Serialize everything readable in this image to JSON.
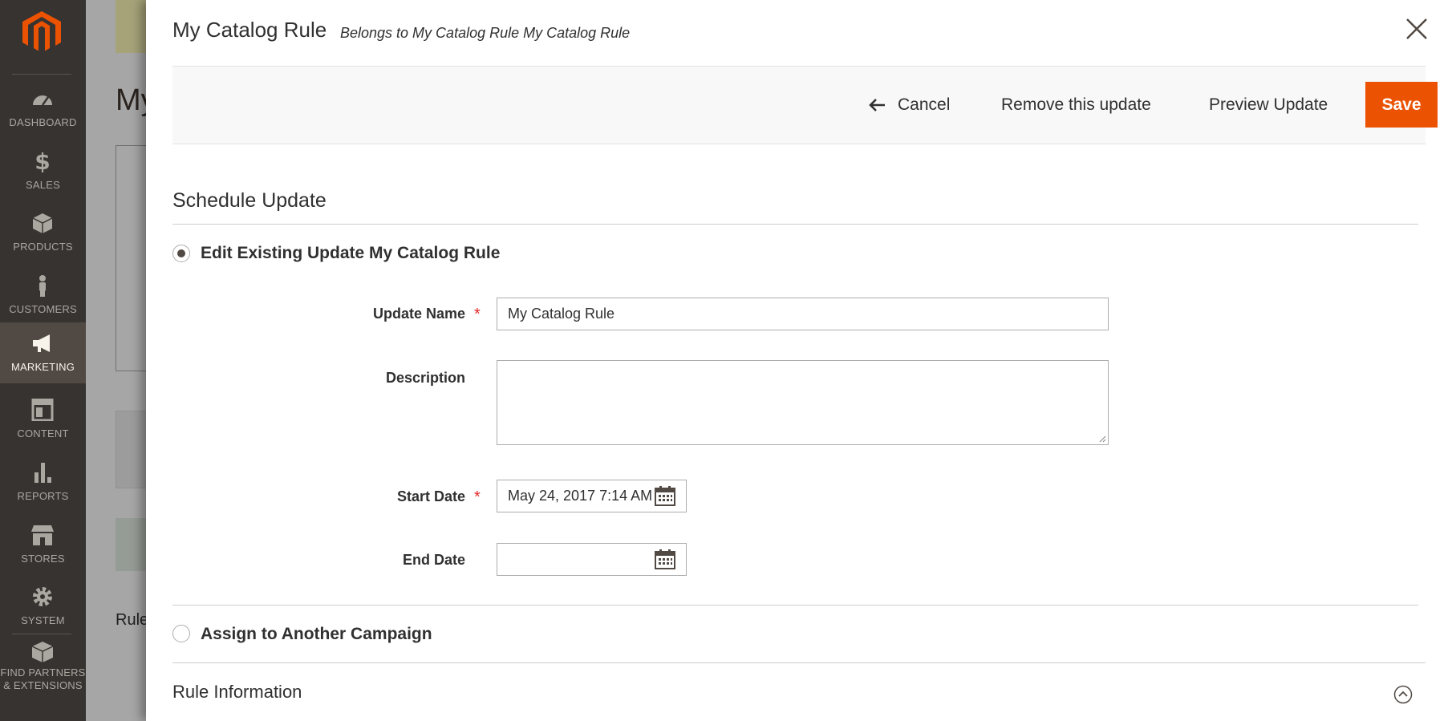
{
  "sidebar": {
    "items": [
      {
        "label": "DASHBOARD"
      },
      {
        "label": "SALES"
      },
      {
        "label": "PRODUCTS"
      },
      {
        "label": "CUSTOMERS"
      },
      {
        "label": "MARKETING"
      },
      {
        "label": "CONTENT"
      },
      {
        "label": "REPORTS"
      },
      {
        "label": "STORES"
      },
      {
        "label": "SYSTEM"
      },
      {
        "label_line1": "FIND PARTNERS",
        "label_line2": "& EXTENSIONS"
      }
    ],
    "active": "MARKETING"
  },
  "background_page": {
    "title_fragment": "My",
    "rule_fragment": "Rule"
  },
  "modal": {
    "title": "My Catalog Rule",
    "subtitle": "Belongs to My Catalog Rule My Catalog Rule",
    "actions": {
      "cancel_label": "Cancel",
      "remove_label": "Remove this update",
      "preview_label": "Preview Update",
      "save_label": "Save"
    },
    "schedule": {
      "section_title": "Schedule Update",
      "edit_option_label": "Edit Existing Update My Catalog Rule",
      "edit_option_selected": true,
      "fields": {
        "update_name_label": "Update Name",
        "update_name_value": "My Catalog Rule",
        "description_label": "Description",
        "description_value": "",
        "start_date_label": "Start Date",
        "start_date_value": "May 24, 2017 7:14 AM",
        "end_date_label": "End Date",
        "end_date_value": ""
      },
      "required_marker": "*",
      "assign_option_label": "Assign to Another Campaign",
      "assign_option_selected": false
    },
    "rule_information": {
      "title": "Rule Information"
    }
  },
  "colors": {
    "sidebar_bg": "#373330",
    "sidebar_active": "#514943",
    "logo": "#eb5202",
    "save_button": "#eb5202",
    "required": "#e22626"
  }
}
